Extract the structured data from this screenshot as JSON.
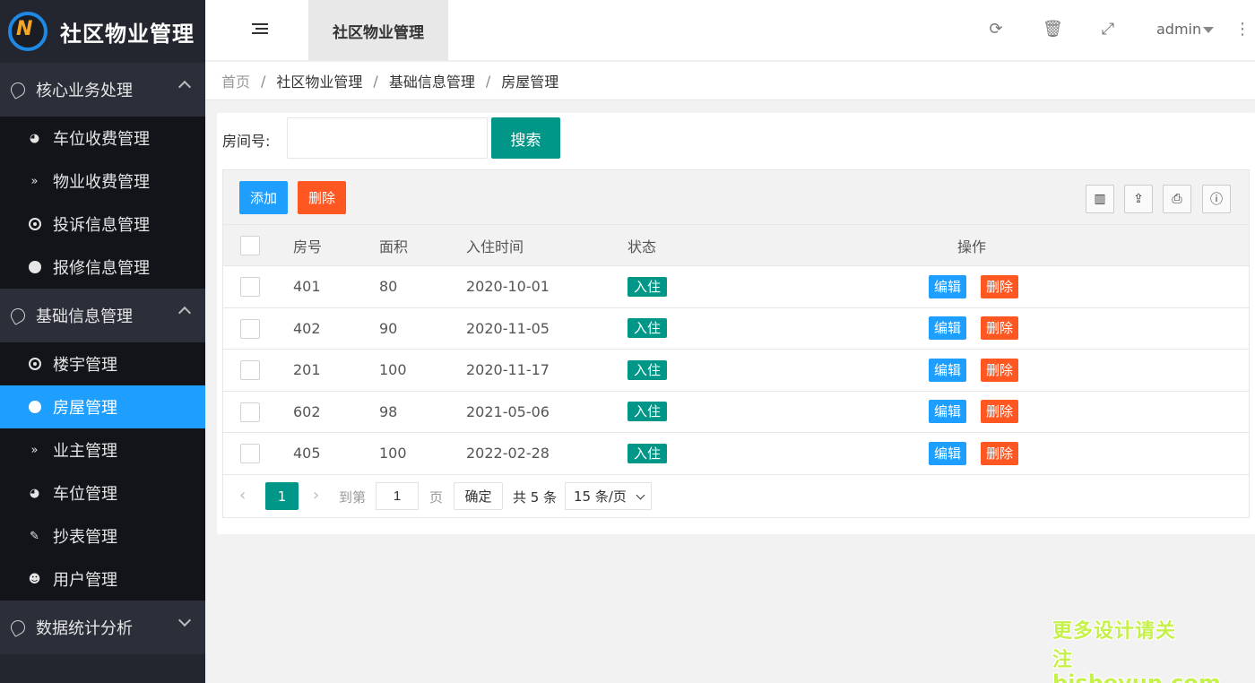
{
  "app": {
    "title": "社区物业管理",
    "logo_letter": "N"
  },
  "sidebar": {
    "groups": [
      {
        "label": "核心业务处理",
        "items": [
          "车位收费管理",
          "物业收费管理",
          "投诉信息管理",
          "报修信息管理"
        ]
      },
      {
        "label": "基础信息管理",
        "items": [
          "楼宇管理",
          "房屋管理",
          "业主管理",
          "车位管理",
          "抄表管理",
          "用户管理"
        ]
      },
      {
        "label": "数据统计分析",
        "items": []
      }
    ],
    "active_item": "房屋管理"
  },
  "header": {
    "active_tab": "社区物业管理",
    "user": "admin",
    "icons": [
      "refresh-icon",
      "trash-icon",
      "fullscreen-icon",
      "more-icon"
    ]
  },
  "breadcrumb": [
    "首页",
    "社区物业管理",
    "基础信息管理",
    "房屋管理"
  ],
  "search": {
    "label": "房间号:",
    "value": "",
    "button": "搜索"
  },
  "toolbar": {
    "add_label": "添加",
    "delete_label": "删除"
  },
  "table": {
    "columns": [
      "房号",
      "面积",
      "入住时间",
      "状态",
      "操作"
    ],
    "rows": [
      {
        "room": "401",
        "area": "80",
        "date": "2020-10-01",
        "status": "入住"
      },
      {
        "room": "402",
        "area": "90",
        "date": "2020-11-05",
        "status": "入住"
      },
      {
        "room": "201",
        "area": "100",
        "date": "2020-11-17",
        "status": "入住"
      },
      {
        "room": "602",
        "area": "98",
        "date": "2021-05-06",
        "status": "入住"
      },
      {
        "room": "405",
        "area": "100",
        "date": "2022-02-28",
        "status": "入住"
      }
    ],
    "edit_label": "编辑",
    "delete_label": "删除"
  },
  "pager": {
    "current": "1",
    "goto_prefix": "到第",
    "goto_value": "1",
    "goto_suffix": "页",
    "confirm": "确定",
    "total": "共 5 条",
    "page_size": "15 条/页"
  },
  "watermark": {
    "line1": "更多设计请关注",
    "line2": "bisheyun.com"
  },
  "colors": {
    "primary": "#009688",
    "blue": "#1e9fff",
    "red": "#ff5722",
    "sidebar": "#23262e"
  }
}
